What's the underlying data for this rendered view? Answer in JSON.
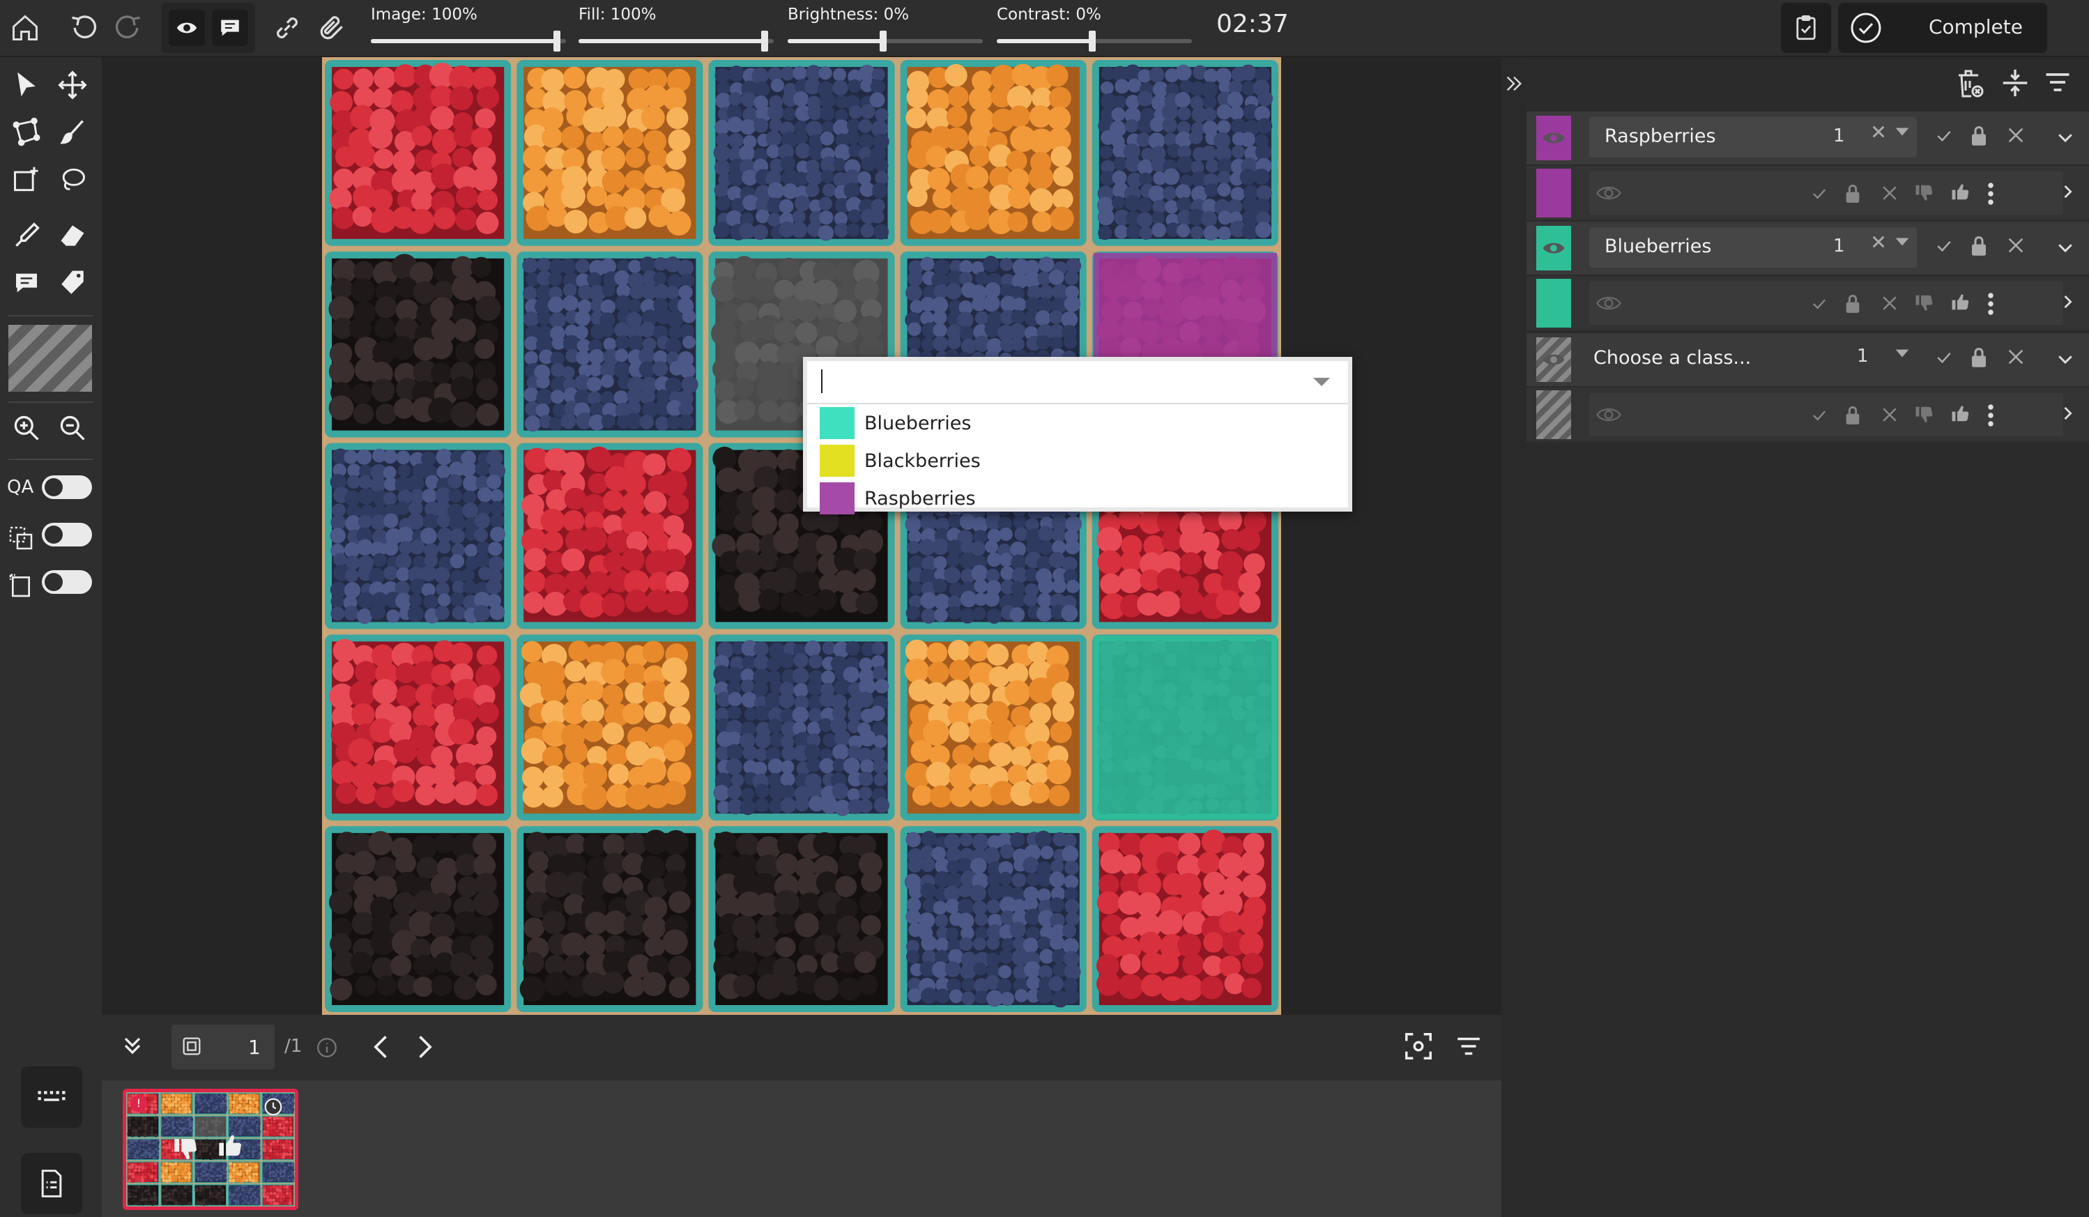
{
  "toolbar": {
    "sliders": [
      {
        "label": "Image: 100%",
        "value": 1.0
      },
      {
        "label": "Fill: 100%",
        "value": 1.0
      },
      {
        "label": "Brightness: 0%",
        "value": 0.5
      },
      {
        "label": "Contrast: 0%",
        "value": 0.5
      }
    ],
    "timer": "02:37",
    "complete_label": "Complete"
  },
  "left_toolbar": {
    "toggles": [
      {
        "label": "QA",
        "on": false
      },
      {
        "label": "",
        "on": false
      },
      {
        "label": "",
        "on": false
      }
    ]
  },
  "navigation": {
    "page_value": "1",
    "page_total": "/1"
  },
  "dropdown": {
    "input_value": "",
    "options": [
      {
        "label": "Blueberries",
        "color": "#3ee0bf"
      },
      {
        "label": "Blackberries",
        "color": "#e2e021"
      },
      {
        "label": "Raspberries",
        "color": "#a64aa8"
      }
    ]
  },
  "annotations": [
    {
      "class_name": "Raspberries",
      "count": "1",
      "color": "#9b3a9e"
    },
    {
      "class_name": "Blueberries",
      "count": "1",
      "color": "#2ebf96"
    },
    {
      "class_name": "Choose a class...",
      "count": "1",
      "color": "striped"
    }
  ],
  "colors": {
    "raspberry_overlay": "#9b3a9e",
    "blueberry_overlay": "#2ebf96",
    "thumbnail_border": "#e0254a"
  },
  "image_grid": [
    [
      "raspberry",
      "golden",
      "blueberry",
      "golden",
      "blueberry"
    ],
    [
      "blackberry",
      "blueberry",
      "grey",
      "blueberry",
      "raspberry"
    ],
    [
      "blueberry",
      "raspberry",
      "blackberry",
      "blueberry",
      "raspberry"
    ],
    [
      "raspberry",
      "golden",
      "blueberry",
      "golden",
      "blueberry"
    ],
    [
      "blackberry",
      "blackberry",
      "blackberry",
      "blueberry",
      "raspberry"
    ]
  ]
}
